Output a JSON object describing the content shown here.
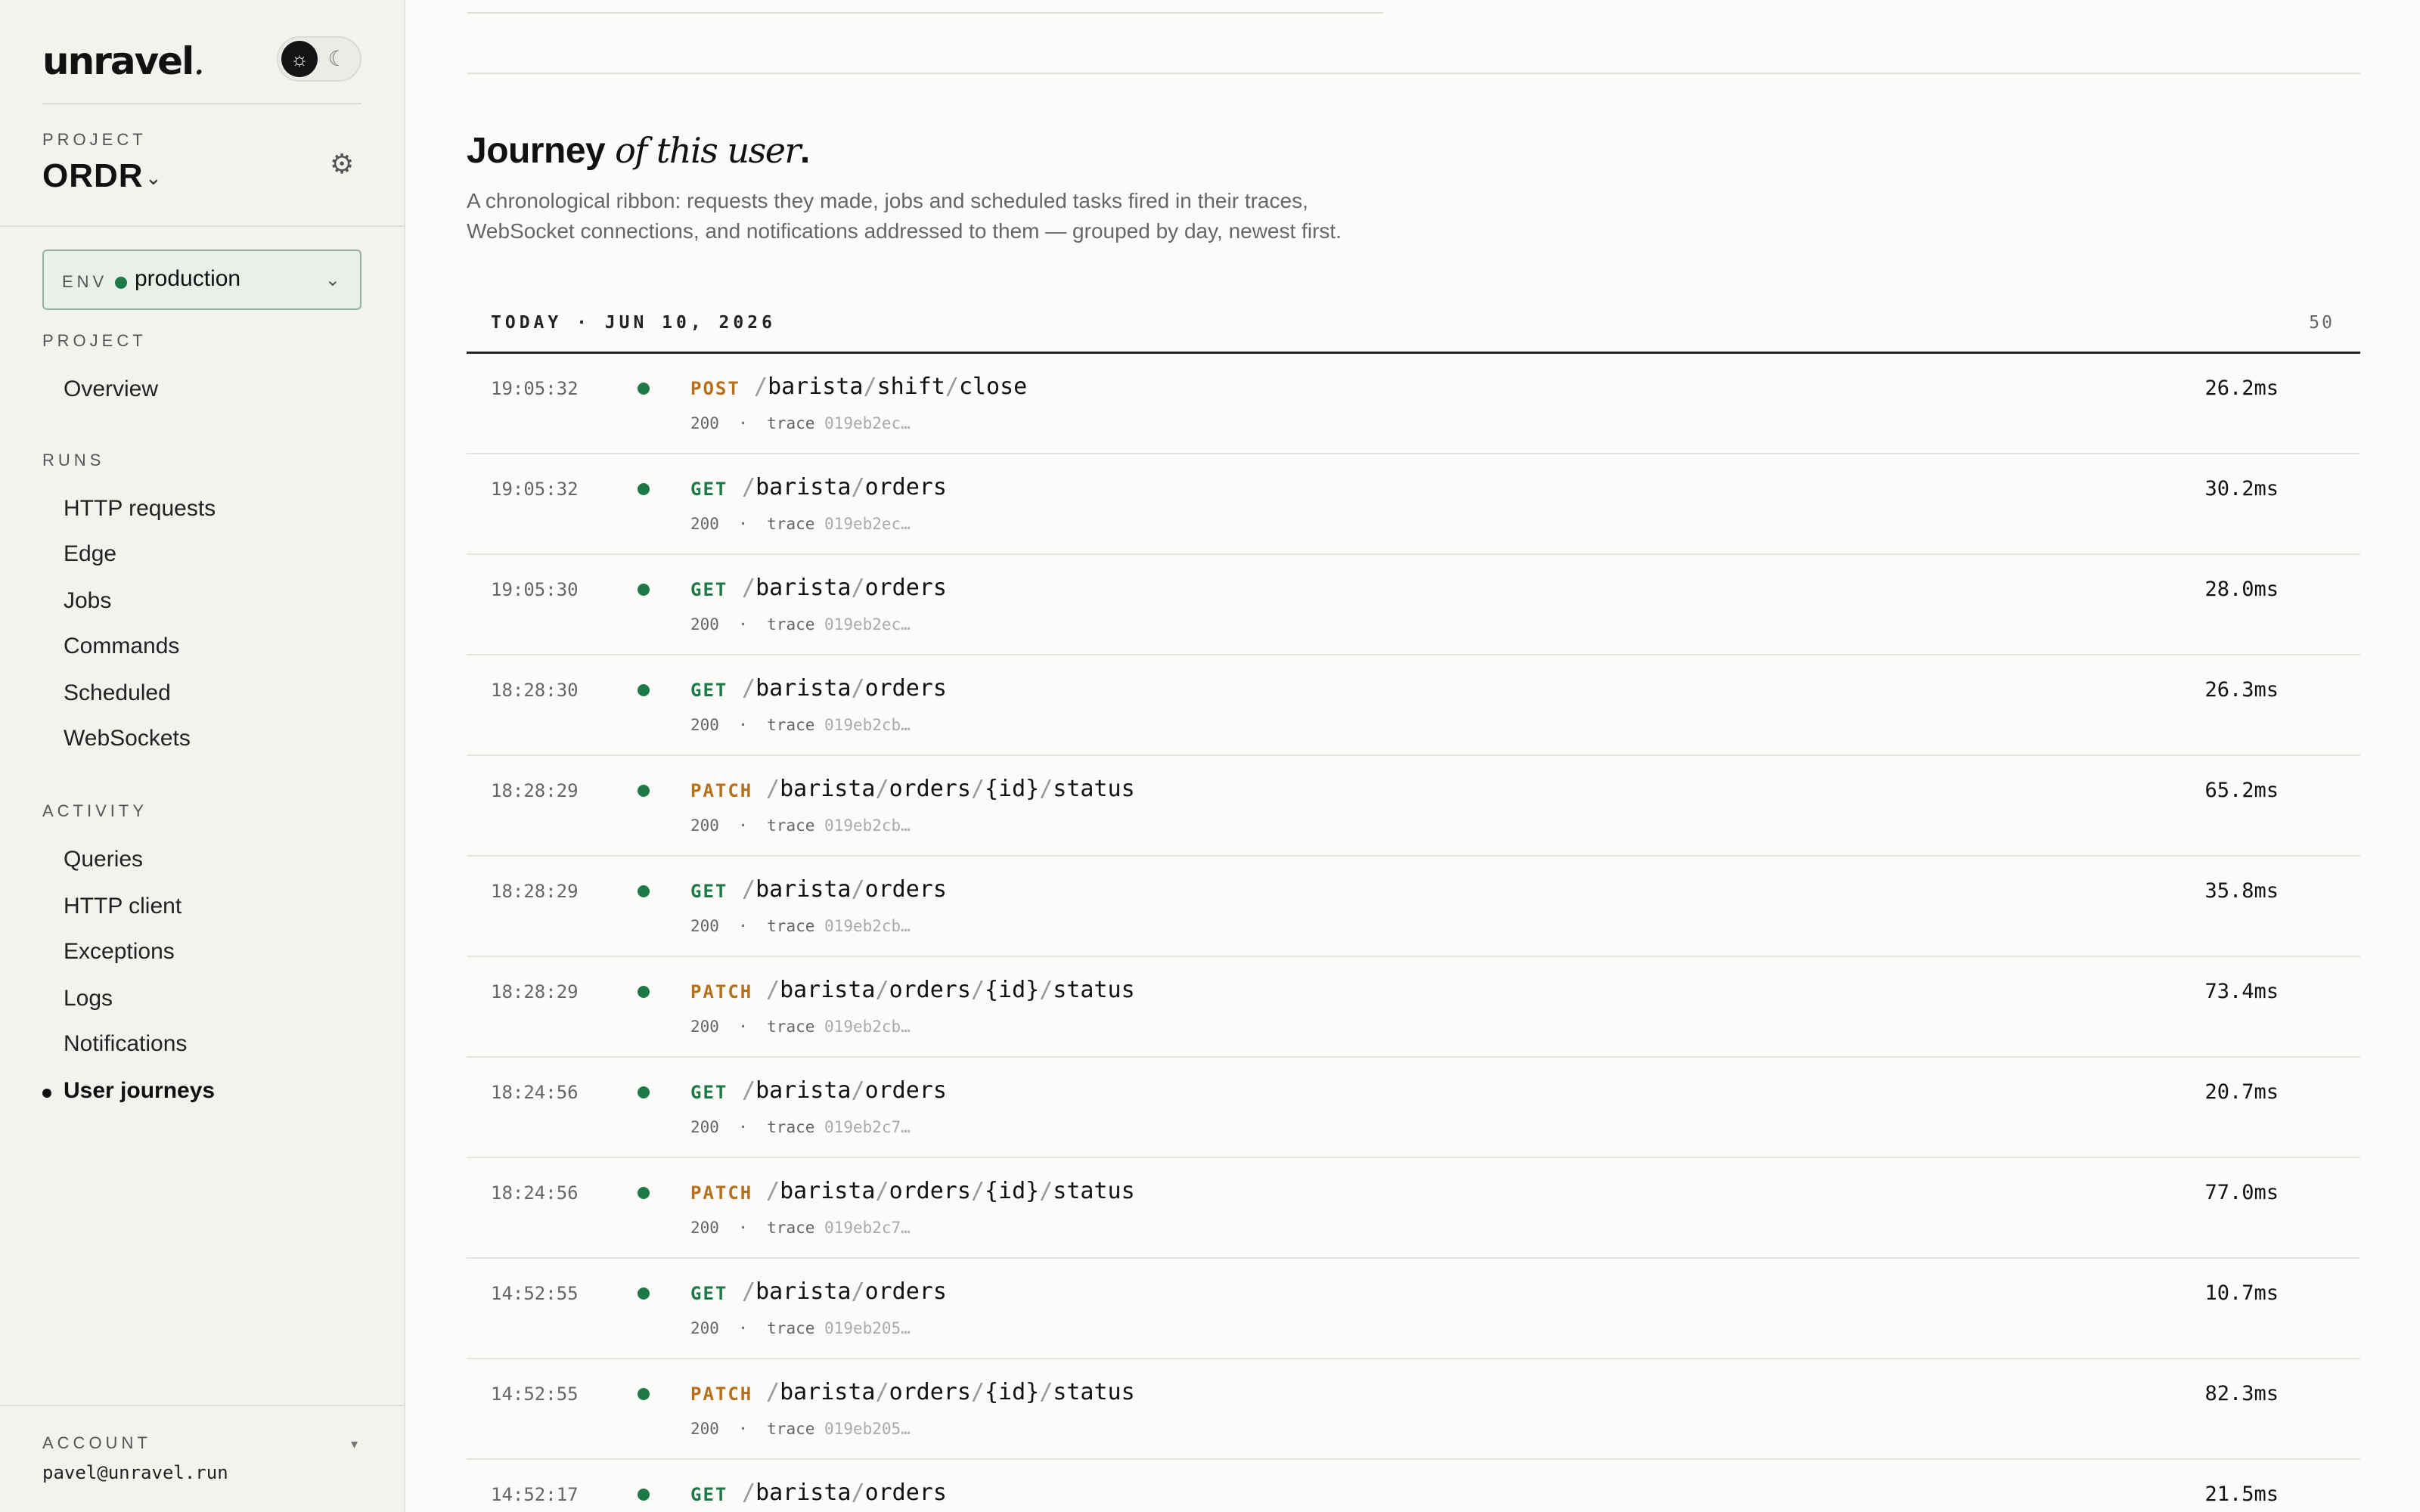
{
  "brand": {
    "name": "unravel",
    "suffix": "."
  },
  "theme": {
    "light_icon": "sun-icon",
    "dark_icon": "moon-icon"
  },
  "project": {
    "label": "PROJECT",
    "name": "ORDR",
    "settings_icon": "gear-icon"
  },
  "env": {
    "label": "ENV",
    "value": "production",
    "status_color": "#1d7a46"
  },
  "nav": {
    "project": {
      "label": "PROJECT",
      "items": [
        "Overview"
      ]
    },
    "runs": {
      "label": "RUNS",
      "items": [
        "HTTP requests",
        "Edge",
        "Jobs",
        "Commands",
        "Scheduled",
        "WebSockets"
      ]
    },
    "activity": {
      "label": "ACTIVITY",
      "items": [
        "Queries",
        "HTTP client",
        "Exceptions",
        "Logs",
        "Notifications",
        "User journeys"
      ]
    },
    "active_item": "User journeys"
  },
  "account": {
    "label": "ACCOUNT",
    "email": "pavel@unravel.run"
  },
  "page": {
    "title_bold": "Journey",
    "title_italic": "of this user",
    "title_end": ".",
    "subtitle": "A chronological ribbon: requests they made, jobs and scheduled tasks fired in their traces, WebSocket connections, and notifications addressed to them — grouped by day, newest first."
  },
  "day": {
    "label": "TODAY · JUN 10, 2026",
    "count": "50"
  },
  "colors": {
    "get": "#1d7a46",
    "write": "#b5701b",
    "accent": "#1d7a46"
  },
  "entries": [
    {
      "time": "19:05:32",
      "method": "POST",
      "path": "/barista/shift/close",
      "status": "200",
      "trace_label": "trace",
      "trace": "019eb2ec…",
      "duration": "26.2ms"
    },
    {
      "time": "19:05:32",
      "method": "GET",
      "path": "/barista/orders",
      "status": "200",
      "trace_label": "trace",
      "trace": "019eb2ec…",
      "duration": "30.2ms"
    },
    {
      "time": "19:05:30",
      "method": "GET",
      "path": "/barista/orders",
      "status": "200",
      "trace_label": "trace",
      "trace": "019eb2ec…",
      "duration": "28.0ms"
    },
    {
      "time": "18:28:30",
      "method": "GET",
      "path": "/barista/orders",
      "status": "200",
      "trace_label": "trace",
      "trace": "019eb2cb…",
      "duration": "26.3ms"
    },
    {
      "time": "18:28:29",
      "method": "PATCH",
      "path": "/barista/orders/{id}/status",
      "status": "200",
      "trace_label": "trace",
      "trace": "019eb2cb…",
      "duration": "65.2ms"
    },
    {
      "time": "18:28:29",
      "method": "GET",
      "path": "/barista/orders",
      "status": "200",
      "trace_label": "trace",
      "trace": "019eb2cb…",
      "duration": "35.8ms"
    },
    {
      "time": "18:28:29",
      "method": "PATCH",
      "path": "/barista/orders/{id}/status",
      "status": "200",
      "trace_label": "trace",
      "trace": "019eb2cb…",
      "duration": "73.4ms"
    },
    {
      "time": "18:24:56",
      "method": "GET",
      "path": "/barista/orders",
      "status": "200",
      "trace_label": "trace",
      "trace": "019eb2c7…",
      "duration": "20.7ms"
    },
    {
      "time": "18:24:56",
      "method": "PATCH",
      "path": "/barista/orders/{id}/status",
      "status": "200",
      "trace_label": "trace",
      "trace": "019eb2c7…",
      "duration": "77.0ms"
    },
    {
      "time": "14:52:55",
      "method": "GET",
      "path": "/barista/orders",
      "status": "200",
      "trace_label": "trace",
      "trace": "019eb205…",
      "duration": "10.7ms"
    },
    {
      "time": "14:52:55",
      "method": "PATCH",
      "path": "/barista/orders/{id}/status",
      "status": "200",
      "trace_label": "trace",
      "trace": "019eb205…",
      "duration": "82.3ms"
    },
    {
      "time": "14:52:17",
      "method": "GET",
      "path": "/barista/orders",
      "status": "",
      "trace_label": "",
      "trace": "",
      "duration": "21.5ms"
    }
  ]
}
